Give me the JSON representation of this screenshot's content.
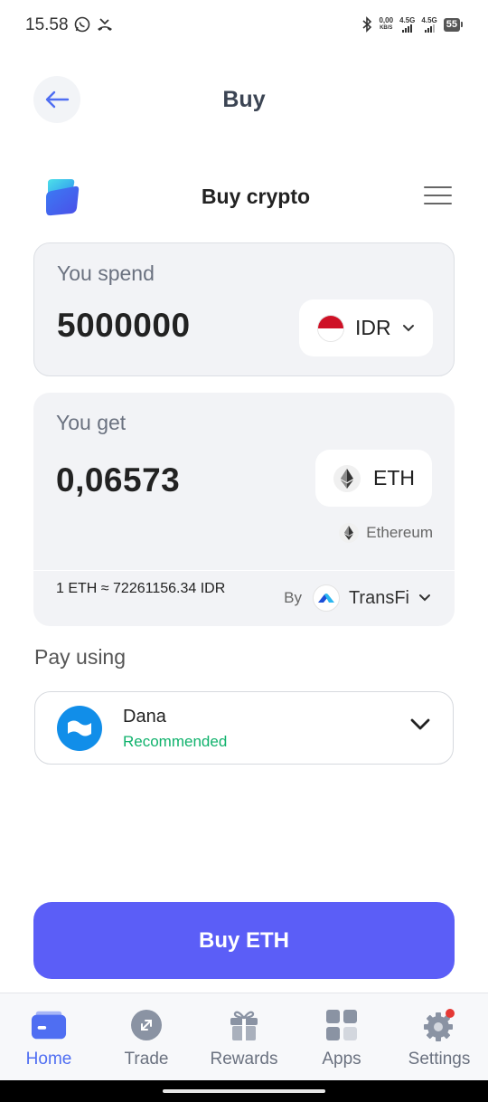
{
  "status_bar": {
    "time": "15.58",
    "net_speed_value": "0,00",
    "net_speed_unit": "KB/S",
    "signal1_label": "4.5G",
    "signal2_label": "4.5G",
    "battery": "55"
  },
  "header": {
    "title": "Buy"
  },
  "widget": {
    "title": "Buy crypto"
  },
  "spend": {
    "label": "You spend",
    "amount": "5000000",
    "currency": "IDR"
  },
  "get": {
    "label": "You get",
    "amount": "0,06573",
    "currency": "ETH",
    "network": "Ethereum"
  },
  "rate": {
    "text": "1 ETH ≈ 72261156.34 IDR",
    "by_label": "By",
    "provider": "TransFi"
  },
  "pay": {
    "label": "Pay using",
    "method": "Dana",
    "method_sub": "Recommended"
  },
  "buy_button": {
    "label": "Buy ETH"
  },
  "nav": {
    "items": [
      {
        "label": "Home",
        "icon": "wallet-icon",
        "active": true
      },
      {
        "label": "Trade",
        "icon": "trade-icon"
      },
      {
        "label": "Rewards",
        "icon": "gift-icon"
      },
      {
        "label": "Apps",
        "icon": "apps-grid-icon"
      },
      {
        "label": "Settings",
        "icon": "gear-icon"
      }
    ]
  },
  "colors": {
    "accent": "#5b5ef7",
    "nav_active": "#4f6ef2",
    "recommended": "#10b26c",
    "dana_blue": "#118ee9"
  }
}
